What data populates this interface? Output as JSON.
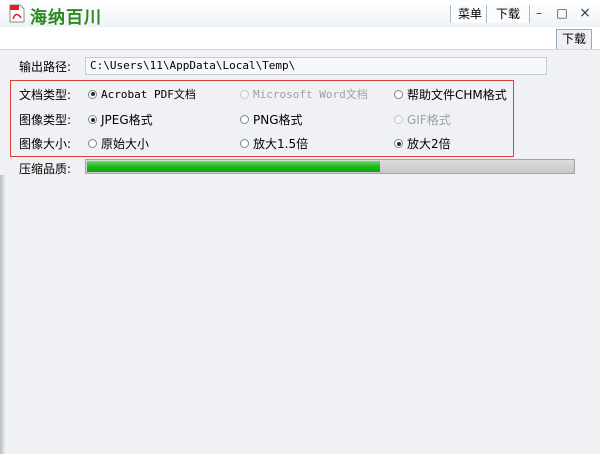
{
  "app": {
    "title": "海纳百川"
  },
  "titlebar": {
    "menu_label": "菜单",
    "download_label": "下载",
    "minimize": "–",
    "maximize": "□",
    "close": "×"
  },
  "tabs": [
    {
      "label": "下载"
    }
  ],
  "output": {
    "label": "输出路径:",
    "value": "C:\\Users\\11\\AppData\\Local\\Temp\\"
  },
  "doc_type": {
    "label": "文档类型:",
    "options": [
      {
        "label": "Acrobat PDF文档",
        "checked": true,
        "enabled": true
      },
      {
        "label": "Microsoft Word文档",
        "checked": false,
        "enabled": false
      },
      {
        "label": "帮助文件CHM格式",
        "checked": false,
        "enabled": true
      }
    ]
  },
  "image_type": {
    "label": "图像类型:",
    "options": [
      {
        "label": "JPEG格式",
        "checked": true,
        "enabled": true
      },
      {
        "label": "PNG格式",
        "checked": false,
        "enabled": true
      },
      {
        "label": "GIF格式",
        "checked": false,
        "enabled": false
      }
    ]
  },
  "image_size": {
    "label": "图像大小:",
    "options": [
      {
        "label": "原始大小",
        "checked": false,
        "enabled": true
      },
      {
        "label": "放大1.5倍",
        "checked": false,
        "enabled": true
      },
      {
        "label": "放大2倍",
        "checked": true,
        "enabled": true
      }
    ]
  },
  "quality": {
    "label": "压缩品质:",
    "level": 0.6
  },
  "colors": {
    "accent_green": "#2a8a1f",
    "highlight_border": "#d9413a",
    "progress_fill": "#1eb81e"
  }
}
